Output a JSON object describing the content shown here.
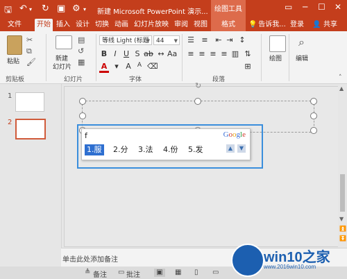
{
  "titlebar": {
    "title": "新建 Microsoft PowerPoint 演示...",
    "context_group": "绘图工具"
  },
  "tabs": [
    "文件",
    "开始",
    "插入",
    "设计",
    "切换",
    "动画",
    "幻灯片放映",
    "审阅",
    "视图"
  ],
  "context_tab": "格式",
  "tell_me": "告诉我...",
  "login": "登录",
  "share": "共享",
  "ribbon": {
    "paste": "粘贴",
    "clipboard": "剪贴板",
    "new_slide_line1": "新建",
    "new_slide_line2": "幻灯片",
    "slides": "幻灯片",
    "font_name": "等线 Light (标题",
    "font_size": "44",
    "font": "字体",
    "paragraph": "段落",
    "drawing": "绘图",
    "editing": "编辑"
  },
  "slides": [
    "1",
    "2"
  ],
  "ime": {
    "composition": "f",
    "brand": "Google",
    "candidates": [
      "1.服",
      "2.分",
      "3.法",
      "4.份",
      "5.发"
    ]
  },
  "notes_placeholder": "单击此处添加备注",
  "status": {
    "notes": "备注",
    "comments": "批注"
  },
  "watermark": {
    "brand": "win10之家",
    "url": "www.2016win10.com"
  }
}
